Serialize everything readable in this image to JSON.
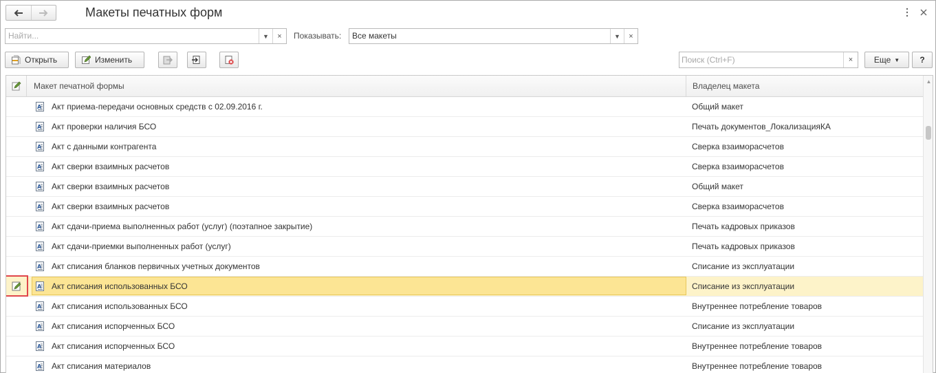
{
  "window": {
    "title": "Макеты печатных форм",
    "menu_icon": "vertical-dots-icon",
    "close_icon": "close-icon"
  },
  "filter": {
    "search_placeholder": "Найти...",
    "show_label": "Показывать:",
    "show_value": "Все макеты"
  },
  "toolbar": {
    "open_label": "Открыть",
    "edit_label": "Изменить",
    "search_placeholder": "Поиск (Ctrl+F)",
    "more_label": "Еще",
    "help_label": "?"
  },
  "grid": {
    "columns": {
      "name": "Макет печатной формы",
      "owner": "Владелец макета"
    },
    "rows": [
      {
        "name": "Акт приема-передачи основных средств с 02.09.2016 г.",
        "owner": "Общий макет",
        "changed": false
      },
      {
        "name": "Акт проверки наличия БСО",
        "owner": "Печать документов_ЛокализацияКА",
        "changed": false
      },
      {
        "name": "Акт с данными контрагента",
        "owner": "Сверка взаиморасчетов",
        "changed": false
      },
      {
        "name": "Акт сверки взаимных расчетов",
        "owner": "Сверка взаиморасчетов",
        "changed": false
      },
      {
        "name": "Акт сверки взаимных расчетов",
        "owner": "Общий макет",
        "changed": false
      },
      {
        "name": "Акт сверки взаимных расчетов",
        "owner": "Сверка взаиморасчетов",
        "changed": false
      },
      {
        "name": "Акт сдачи-приема выполненных работ (услуг) (поэтапное закрытие)",
        "owner": "Печать кадровых приказов",
        "changed": false
      },
      {
        "name": "Акт сдачи-приемки выполненных работ (услуг)",
        "owner": "Печать кадровых приказов",
        "changed": false
      },
      {
        "name": "Акт списания бланков первичных учетных документов",
        "owner": "Списание из эксплуатации",
        "changed": false
      },
      {
        "name": "Акт списания использованных БСО",
        "owner": "Списание из эксплуатации",
        "changed": true,
        "selected": true
      },
      {
        "name": "Акт списания использованных БСО",
        "owner": "Внутреннее потребление товаров",
        "changed": false
      },
      {
        "name": "Акт списания испорченных БСО",
        "owner": "Списание из эксплуатации",
        "changed": false
      },
      {
        "name": "Акт списания испорченных БСО",
        "owner": "Внутреннее потребление товаров",
        "changed": false
      },
      {
        "name": "Акт списания материалов",
        "owner": "Внутреннее потребление товаров",
        "changed": false
      }
    ]
  },
  "colors": {
    "selected_row": "#fdf3c9",
    "selected_cell": "#fce594",
    "highlight_frame": "#e0454b"
  }
}
